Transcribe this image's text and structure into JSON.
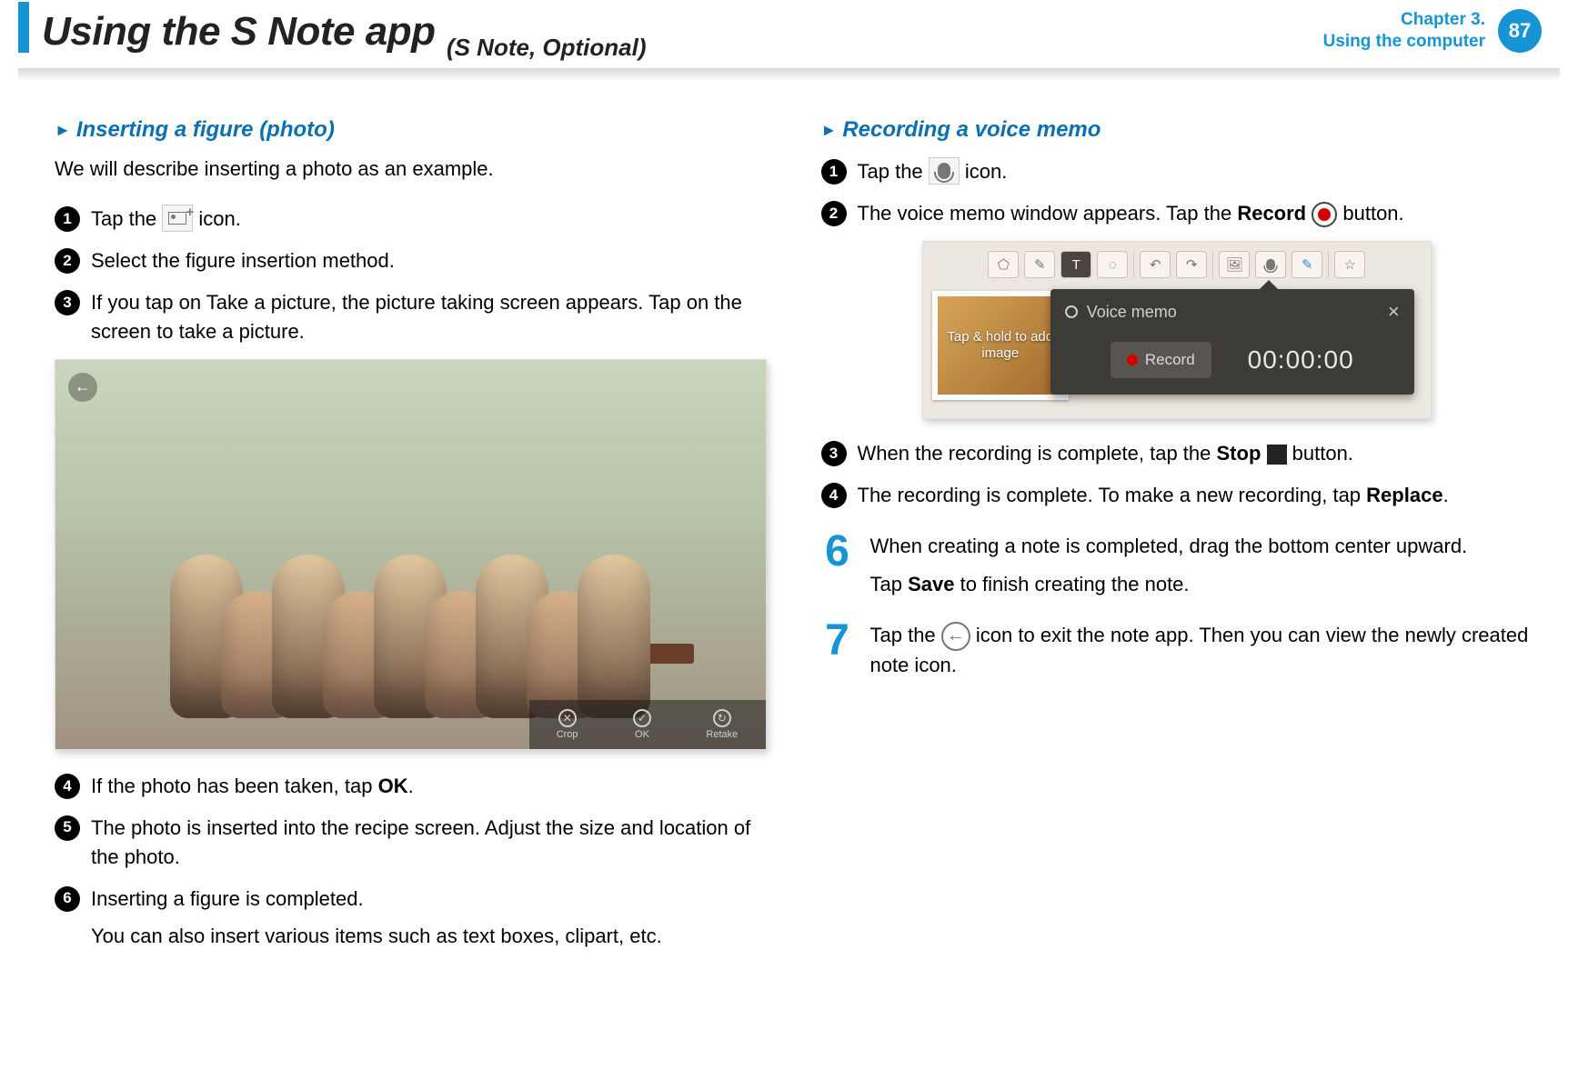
{
  "header": {
    "title": "Using the S Note app",
    "subtitle": "(S Note, Optional)",
    "chapter_line1": "Chapter 3.",
    "chapter_line2": "Using the computer",
    "page_number": "87"
  },
  "left": {
    "section_title": "Inserting a figure (photo)",
    "intro": "We will describe inserting a photo as an example.",
    "steps": {
      "s1_a": "Tap the ",
      "s1_b": " icon.",
      "s2": "Select the figure insertion method.",
      "s3": "If you tap on Take a picture, the picture taking screen appears. Tap on the screen to take a picture.",
      "s4_a": "If the photo has been taken, tap ",
      "s4_ok": "OK",
      "s4_b": ".",
      "s5": "The photo is inserted into the recipe screen. Adjust the size and location of the photo.",
      "s6": "Inserting a figure is completed.",
      "s6_sub": "You can also insert various items such as text boxes, clipart, etc."
    },
    "photo_toolbar": {
      "crop": "Crop",
      "ok": "OK",
      "retake": "Retake"
    }
  },
  "right": {
    "section_title": "Recording a voice memo",
    "steps": {
      "s1_a": "Tap the ",
      "s1_b": " icon.",
      "s2_a": "The voice memo window appears. Tap the ",
      "s2_rec": "Record",
      "s2_b": " button.",
      "s3_a": "When the recording is complete, tap the ",
      "s3_stop": "Stop",
      "s3_b": " button.",
      "s4_a": "The recording is complete. To make a new recording, tap ",
      "s4_rep": "Replace",
      "s4_b": "."
    },
    "big6_a": "When creating a note is completed, drag the bottom center upward.",
    "big6_b_a": "Tap ",
    "big6_b_save": "Save",
    "big6_b_b": " to finish creating the note.",
    "big7_a": "Tap the ",
    "big7_b": " icon to exit the note app. Then you can view the newly created note icon.",
    "voice_memo": {
      "thumb_text": "Tap & hold to add image",
      "popup_title": "Voice memo",
      "record_label": "Record",
      "time": "00:00:00"
    }
  }
}
